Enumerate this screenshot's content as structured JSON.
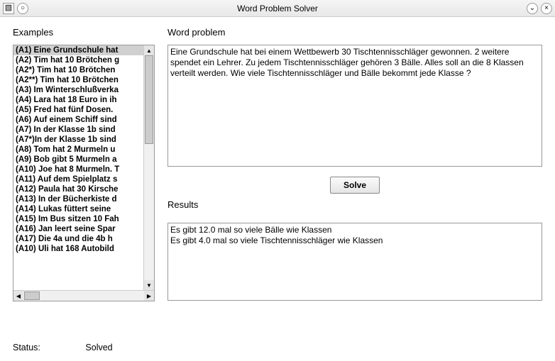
{
  "window": {
    "title": "Word Problem Solver"
  },
  "sections": {
    "examples": "Examples",
    "word_problem": "Word problem",
    "results": "Results",
    "status_label": "Status:",
    "status_value": "Solved"
  },
  "buttons": {
    "solve": "Solve"
  },
  "word_problem_text": "Eine Grundschule hat bei einem Wettbewerb 30 Tischtennisschläger gewonnen. 2 weitere spendet ein Lehrer. Zu jedem Tischtennisschläger gehören 3 Bälle. Alles soll an die 8 Klassen verteilt werden. Wie viele Tischtennisschläger und Bälle bekommt jede Klasse ?",
  "results_text": "Es gibt 12.0 mal so viele Bälle wie Klassen\nEs gibt 4.0 mal so viele Tischtennisschläger wie Klassen",
  "examples_selected_index": 0,
  "examples_items": [
    "(A1) Eine Grundschule hat",
    "(A2) Tim hat 10 Brötchen g",
    "(A2*) Tim hat 10 Brötchen",
    "(A2**) Tim hat 10 Brötchen",
    "(A3) Im Winterschlußverka",
    "(A4) Lara hat 18 Euro in ih",
    "(A5) Fred hat fünf Dosen.",
    "(A6) Auf einem Schiff sind",
    "(A7) In der Klasse 1b sind",
    "(A7*)In der Klasse 1b sind",
    "(A8) Tom hat 2 Murmeln u",
    "(A9) Bob gibt 5 Murmeln a",
    "(A10) Joe hat 8 Murmeln. T",
    "(A11) Auf dem Spielplatz s",
    "(A12) Paula hat 30 Kirsche",
    "(A13) In der Bücherkiste d",
    "(A14) Lukas füttert seine",
    "(A15) Im Bus sitzen 10 Fah",
    "(A16) Jan leert seine Spar",
    "(A17) Die 4a und die 4b h",
    "(A10) Uli hat 168 Autobild"
  ]
}
